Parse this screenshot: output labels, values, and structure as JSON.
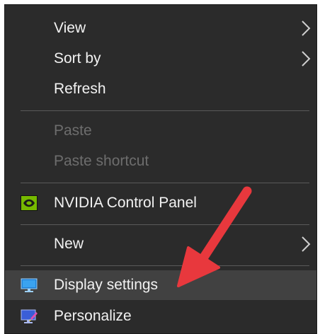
{
  "context_menu": {
    "items": [
      {
        "label": "View",
        "icon": "",
        "submenu": true,
        "disabled": false
      },
      {
        "label": "Sort by",
        "icon": "",
        "submenu": true,
        "disabled": false
      },
      {
        "label": "Refresh",
        "icon": "",
        "submenu": false,
        "disabled": false
      },
      {
        "label": "Paste",
        "icon": "",
        "submenu": false,
        "disabled": true
      },
      {
        "label": "Paste shortcut",
        "icon": "",
        "submenu": false,
        "disabled": true
      },
      {
        "label": "NVIDIA Control Panel",
        "icon": "nvidia-icon",
        "submenu": false,
        "disabled": false
      },
      {
        "label": "New",
        "icon": "",
        "submenu": true,
        "disabled": false
      },
      {
        "label": "Display settings",
        "icon": "display-settings-icon",
        "submenu": false,
        "disabled": false,
        "highlighted": true
      },
      {
        "label": "Personalize",
        "icon": "personalize-icon",
        "submenu": false,
        "disabled": false
      }
    ]
  },
  "colors": {
    "menu_background": "#2b2b2b",
    "hover_background": "#414141",
    "text": "#f2f2f2",
    "disabled_text": "#6d6d6d",
    "annotation_arrow": "#e8383d"
  },
  "annotation": {
    "icon": "red-arrow-icon"
  }
}
